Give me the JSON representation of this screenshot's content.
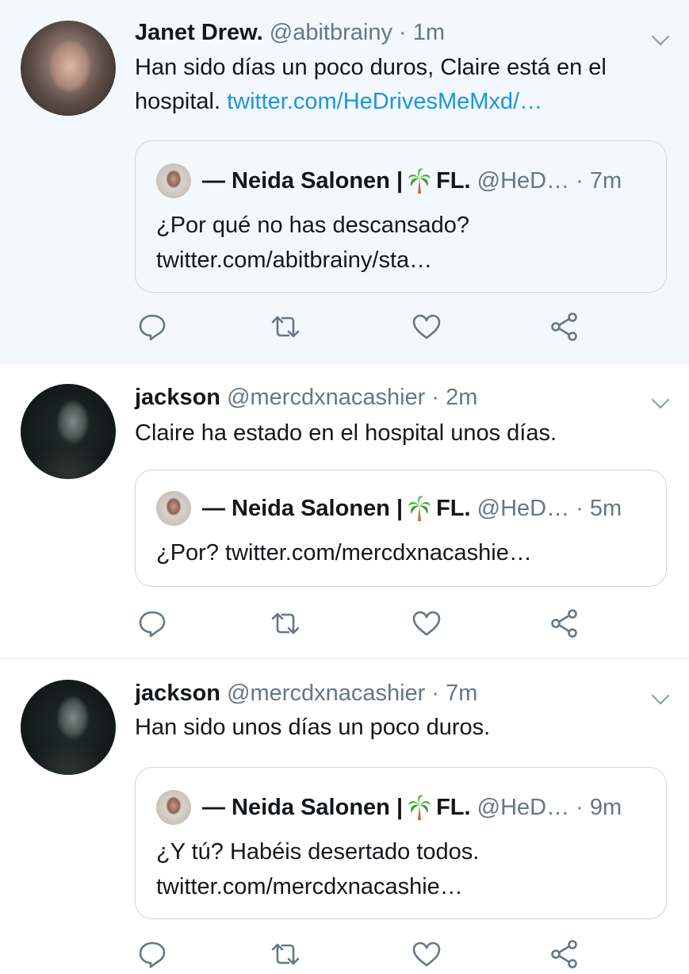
{
  "tweets": [
    {
      "name": "Janet Drew.",
      "handle": "@abitbrainy",
      "time": "· 1m",
      "text_prefix": "Han sido días un poco duros, Claire está en el hospital.",
      "text_link": "twitter.com/HeDrivesMeMxd/…",
      "quote": {
        "name": "— Neida Salonen | ",
        "flag": "FL.",
        "handle": "@HeD…",
        "time": "· 7m",
        "text": "¿Por qué no has descansado? twitter.com/abitbrainy/sta…"
      }
    },
    {
      "name": "jackson",
      "handle": "@mercdxnacashier",
      "time": "· 2m",
      "text_prefix": "Claire ha estado en el hospital unos días.",
      "quote": {
        "name": "— Neida Salonen | ",
        "flag": "FL.",
        "handle": "@HeD…",
        "time": "· 5m",
        "text": "¿Por? twitter.com/mercdxnacashie…"
      }
    },
    {
      "name": "jackson",
      "handle": "@mercdxnacashier",
      "time": "· 7m",
      "text_prefix": "Han sido unos días un poco duros.",
      "quote": {
        "name": "— Neida Salonen | ",
        "flag": "FL.",
        "handle": "@HeD…",
        "time": "· 9m",
        "text": "¿Y tú? Habéis desertado todos. twitter.com/mercdxnacashie…"
      }
    }
  ],
  "icons": {
    "reply": "reply-icon",
    "retweet": "retweet-icon",
    "like": "like-icon",
    "share": "share-icon",
    "caret": "chevron-down-icon",
    "palm": "palm-tree-emoji"
  },
  "colors": {
    "link": "#1b95e0",
    "secondary_text": "#657786",
    "highlight_bg": "#f3f8fc",
    "border": "#e1e8ed"
  }
}
